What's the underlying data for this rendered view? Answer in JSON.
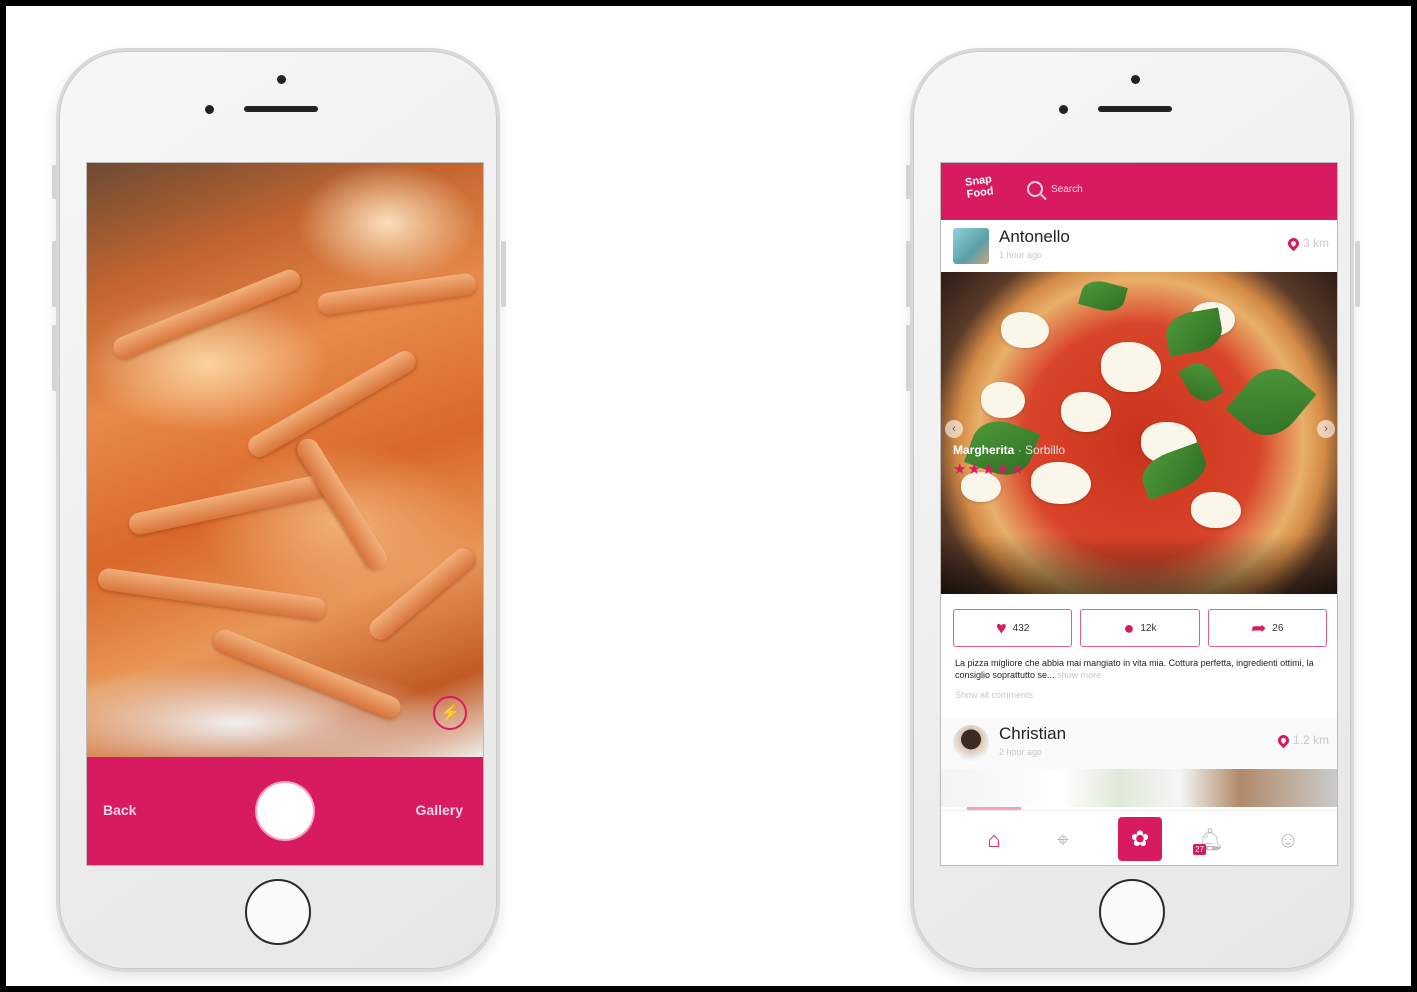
{
  "camera": {
    "back_label": "Back",
    "gallery_label": "Gallery",
    "flash_icon": "⚡"
  },
  "feed": {
    "search_placeholder": "Search",
    "logo_text": "Snap Food",
    "posts": [
      {
        "user": "Antonello",
        "time": "1 hour ago",
        "distance": "3 km",
        "dish": "Margherita",
        "place": "· Sorbillo",
        "rating": "★★★★★",
        "likes": "432",
        "comments_count": "12k",
        "shares": "26",
        "caption": "La pizza migliore che abbia mai mangiato in vita mia. Cottura perfetta, ingredienti ottimi, la consiglio soprattutto se...",
        "show_more": "show more",
        "show_comments": "Show all comments"
      },
      {
        "user": "Christian",
        "time": "2 hour ago",
        "distance": "1.2 km"
      }
    ],
    "tabs": {
      "notifications_badge": "27"
    }
  },
  "colors": {
    "accent": "#d81b60"
  }
}
